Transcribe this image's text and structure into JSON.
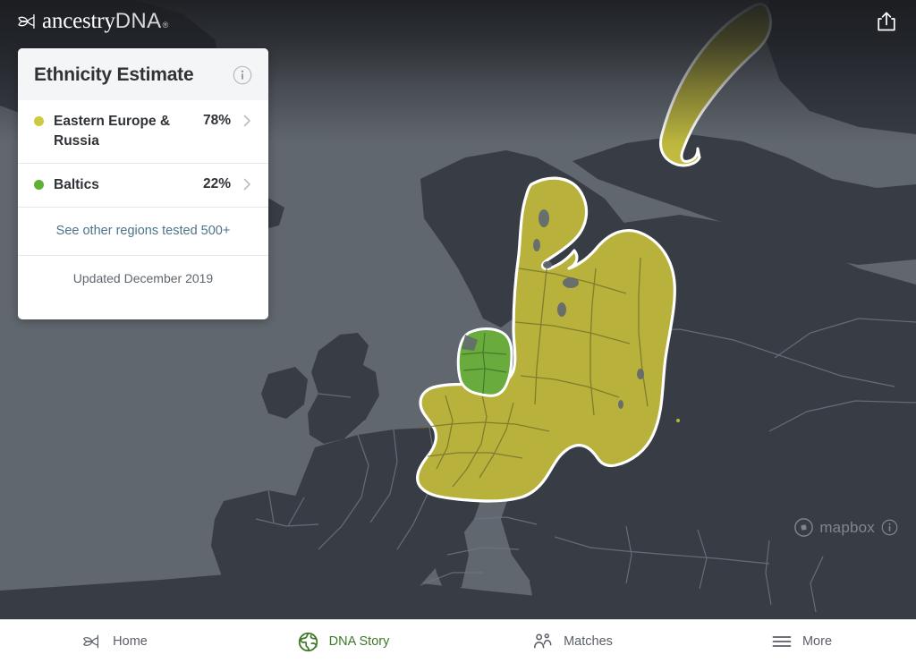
{
  "header": {
    "brand_mark_icon": "ancestry-leaf-icon",
    "brand_name_primary": "ancestry",
    "brand_name_secondary": "DNA",
    "brand_trademark": "®",
    "share_icon": "share-upload-icon"
  },
  "card": {
    "title": "Ethnicity Estimate",
    "info_icon": "info-circle-icon",
    "regions": [
      {
        "name": "Eastern Europe & Russia",
        "percent": "78%",
        "color": "#cfc93f",
        "chevron_icon": "chevron-right-icon"
      },
      {
        "name": "Baltics",
        "percent": "22%",
        "color": "#5fb133",
        "chevron_icon": "chevron-right-icon"
      }
    ],
    "other_regions_link": "See other regions tested 500+",
    "updated_text": "Updated December 2019"
  },
  "map": {
    "ocean_color": "#61676f",
    "land_color": "#383d45",
    "border_color": "#6f757e",
    "region_eastern_europe_color": "#b8b23c",
    "region_baltics_color": "#6aab3e",
    "region_outline_color": "#ffffff",
    "attribution": {
      "logo_icon": "mapbox-logo-icon",
      "label": "mapbox",
      "info_icon": "info-circle-icon"
    }
  },
  "bottom_nav": {
    "items": [
      {
        "label": "Home",
        "icon": "ancestry-leaf-icon",
        "active": false
      },
      {
        "label": "DNA Story",
        "icon": "globe-icon",
        "active": true
      },
      {
        "label": "Matches",
        "icon": "people-icon",
        "active": false
      },
      {
        "label": "More",
        "icon": "hamburger-menu-icon",
        "active": false
      }
    ],
    "active_color": "#3e7829",
    "inactive_color": "#5a5f66"
  }
}
